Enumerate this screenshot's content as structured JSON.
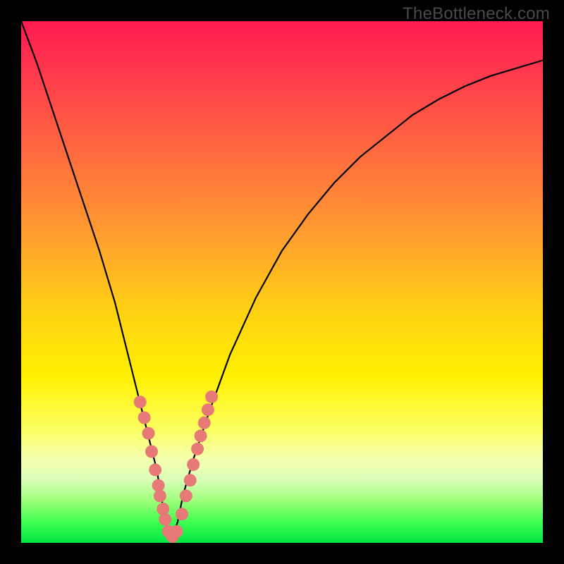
{
  "watermark": "TheBottleneck.com",
  "chart_data": {
    "type": "line",
    "title": "",
    "xlabel": "",
    "ylabel": "",
    "xlim": [
      0,
      100
    ],
    "ylim": [
      0,
      100
    ],
    "gradient_colors": {
      "top": "#ff1a4f",
      "mid_upper": "#ff9a30",
      "mid": "#fff000",
      "mid_lower": "#d9ffb8",
      "bottom": "#00e642"
    },
    "series": [
      {
        "name": "bottleneck-curve",
        "color": "#000000",
        "x": [
          0,
          3,
          6,
          9,
          12,
          15,
          18,
          20,
          22,
          24,
          26,
          27,
          28,
          28.5,
          29,
          30,
          31,
          33,
          36,
          40,
          45,
          50,
          55,
          60,
          65,
          70,
          75,
          80,
          85,
          90,
          95,
          100
        ],
        "values": [
          100,
          92,
          83,
          74,
          65,
          56,
          46,
          38,
          30,
          22,
          14,
          8,
          3,
          1,
          1.2,
          4,
          9,
          16,
          25,
          36,
          47,
          56,
          63,
          69,
          74,
          78,
          82,
          85,
          87.5,
          89.5,
          91,
          92.5
        ]
      }
    ],
    "markers": {
      "name": "data-points",
      "color": "#e77a77",
      "radius": 9,
      "points": [
        {
          "x": 22.8,
          "y": 27
        },
        {
          "x": 23.6,
          "y": 24
        },
        {
          "x": 24.4,
          "y": 21
        },
        {
          "x": 25.0,
          "y": 17.5
        },
        {
          "x": 25.7,
          "y": 14
        },
        {
          "x": 26.3,
          "y": 11
        },
        {
          "x": 26.6,
          "y": 9
        },
        {
          "x": 27.2,
          "y": 6.5
        },
        {
          "x": 27.6,
          "y": 4.5
        },
        {
          "x": 28.2,
          "y": 2.2
        },
        {
          "x": 29.0,
          "y": 1.2
        },
        {
          "x": 29.8,
          "y": 2.2
        },
        {
          "x": 30.8,
          "y": 5.5
        },
        {
          "x": 31.6,
          "y": 9
        },
        {
          "x": 32.4,
          "y": 12
        },
        {
          "x": 33.0,
          "y": 15
        },
        {
          "x": 33.8,
          "y": 18
        },
        {
          "x": 34.4,
          "y": 20.5
        },
        {
          "x": 35.1,
          "y": 23
        },
        {
          "x": 35.8,
          "y": 25.5
        },
        {
          "x": 36.5,
          "y": 28
        }
      ]
    }
  }
}
